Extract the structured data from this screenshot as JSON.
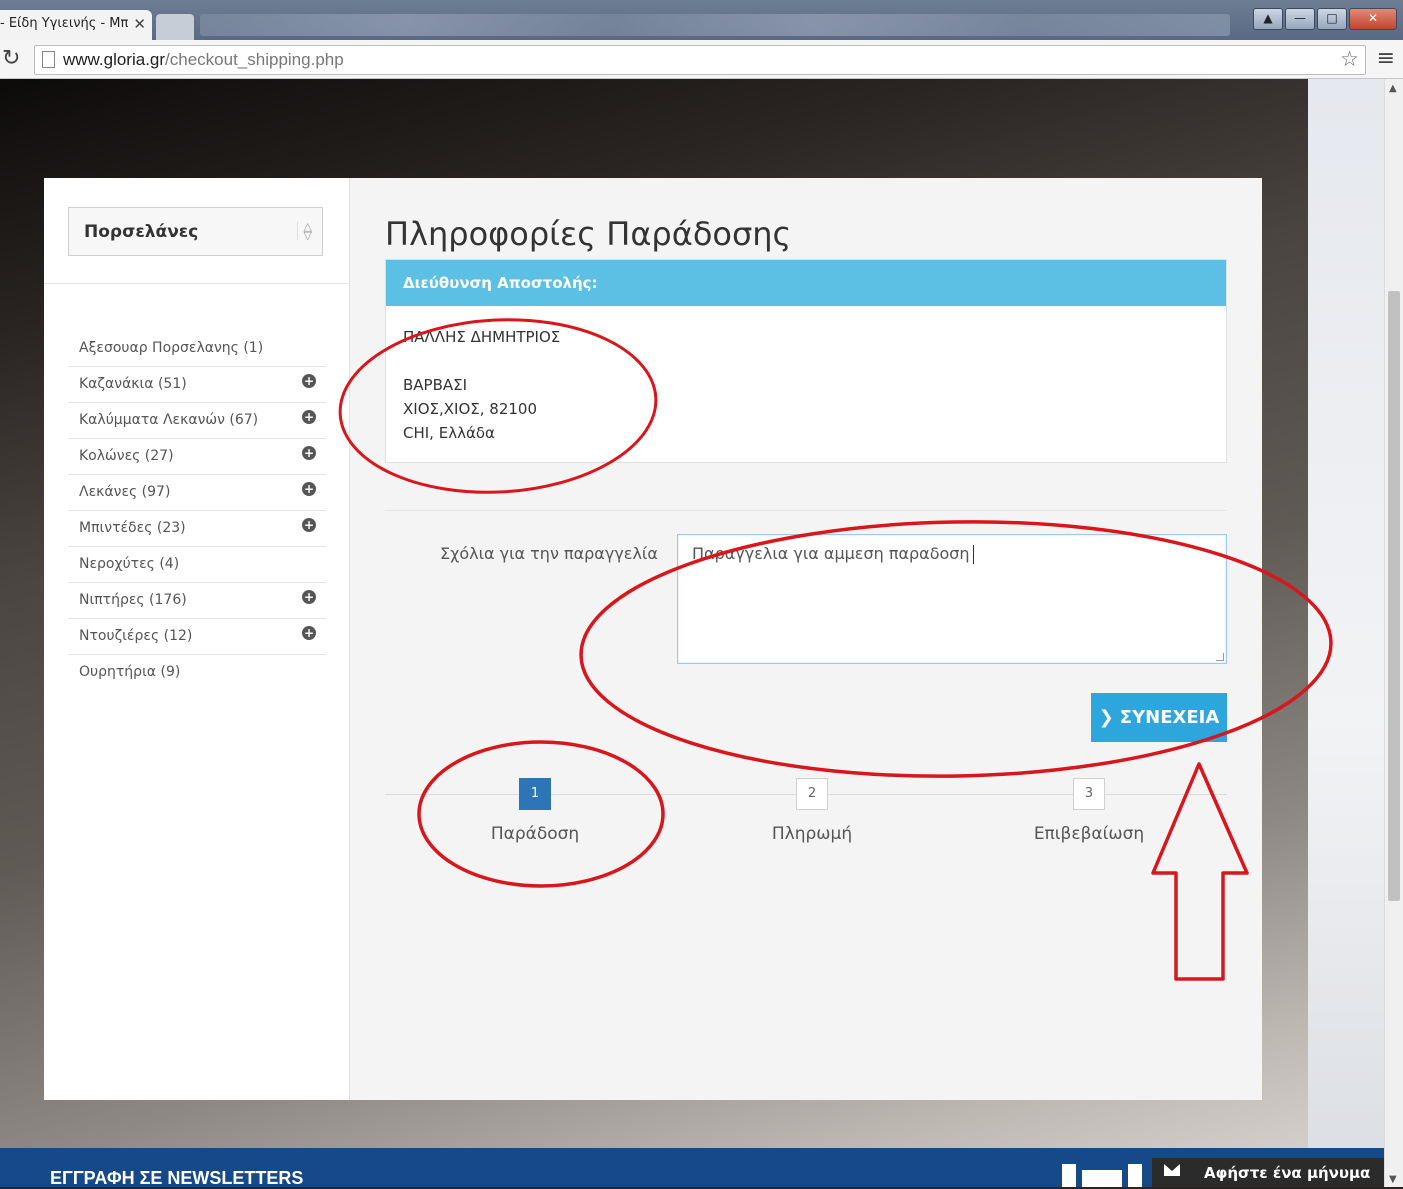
{
  "browser": {
    "tab_title": "- Είδη Υγιεινής - Μπ",
    "tab_close": "✕",
    "url_host": "www.gloria.gr",
    "url_path": "/checkout_shipping.php"
  },
  "sidebar": {
    "category_select": "Πορσελάνες",
    "categories": [
      {
        "label": "Αξεσουαρ Πορσελανης (1)"
      },
      {
        "label": "Καζανάκια (51)"
      },
      {
        "label": "Καλύμματα Λεκανών (67)"
      },
      {
        "label": "Κολώνες (27)"
      },
      {
        "label": "Λεκάνες (97)"
      },
      {
        "label": "Μπιντέδες (23)"
      },
      {
        "label": "Νεροχύτες (4)"
      },
      {
        "label": "Νιπτήρες (176)"
      },
      {
        "label": "Ντουζιέρες (12)"
      },
      {
        "label": "Ουρητήρια (9)"
      }
    ]
  },
  "main": {
    "title": "Πληροφορίες Παράδοσης",
    "address": {
      "heading": "Διεύθυνση Αποστολής:",
      "name": "ΠΑΛΛΗΣ ΔΗΜΗΤΡΙΟΣ",
      "street": "ΒΑΡΒΑΣΙ",
      "city_line": "ΧΙΟΣ,ΧΙΟΣ, 82100",
      "country_line": "CHI, Ελλάδα"
    },
    "comments_label": "Σχόλια για την παραγγελία",
    "comments_value": "Παραγγελια για αμμεση παραδοση",
    "continue_label": "ΣΥΝΕΧΕΙΑ",
    "steps": [
      {
        "num": "1",
        "label": "Παράδοση",
        "active": true
      },
      {
        "num": "2",
        "label": "Πληρωμή",
        "active": false
      },
      {
        "num": "3",
        "label": "Επιβεβαίωση",
        "active": false
      }
    ]
  },
  "footer": {
    "newsletter": "ΕΓΓΡΑΦΗ ΣΕ NEWSLETTERS",
    "message_button": "Αφήστε ένα μήνυμα"
  },
  "colors": {
    "accent": "#5bc0e3",
    "button": "#2ca6dd",
    "step_active": "#2e75b7",
    "footer": "#15498a",
    "annotation": "#d8161c"
  },
  "icons": {
    "reload": "reload-icon",
    "bookmark": "star-icon",
    "menu": "hamburger-menu-icon",
    "expand": "plus-circle-icon",
    "chevron": "chevron-right-icon",
    "mail": "envelope-icon"
  }
}
